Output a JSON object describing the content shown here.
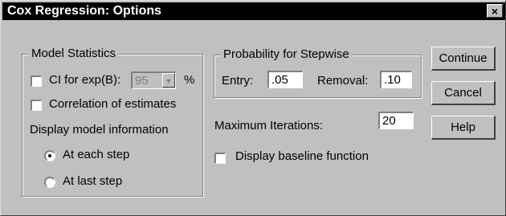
{
  "window": {
    "title": "Cox Regression: Options",
    "close_label": "×"
  },
  "model_statistics": {
    "title": "Model Statistics",
    "ci_label": "CI for exp(B):",
    "ci_checked": false,
    "ci_value": "95",
    "ci_unit": "%",
    "correlation_label": "Correlation of estimates",
    "correlation_checked": false,
    "display_info_label": "Display model information",
    "radios": [
      {
        "label": "At each step",
        "selected": true
      },
      {
        "label": "At last step",
        "selected": false
      }
    ]
  },
  "stepwise": {
    "title": "Probability for Stepwise",
    "entry_label": "Entry:",
    "entry_value": ".05",
    "removal_label": "Removal:",
    "removal_value": ".10"
  },
  "iterations": {
    "label": "Maximum Iterations:",
    "value": "20"
  },
  "baseline": {
    "label": "Display baseline function",
    "checked": false
  },
  "buttons": {
    "continue": "Continue",
    "cancel": "Cancel",
    "help": "Help"
  }
}
